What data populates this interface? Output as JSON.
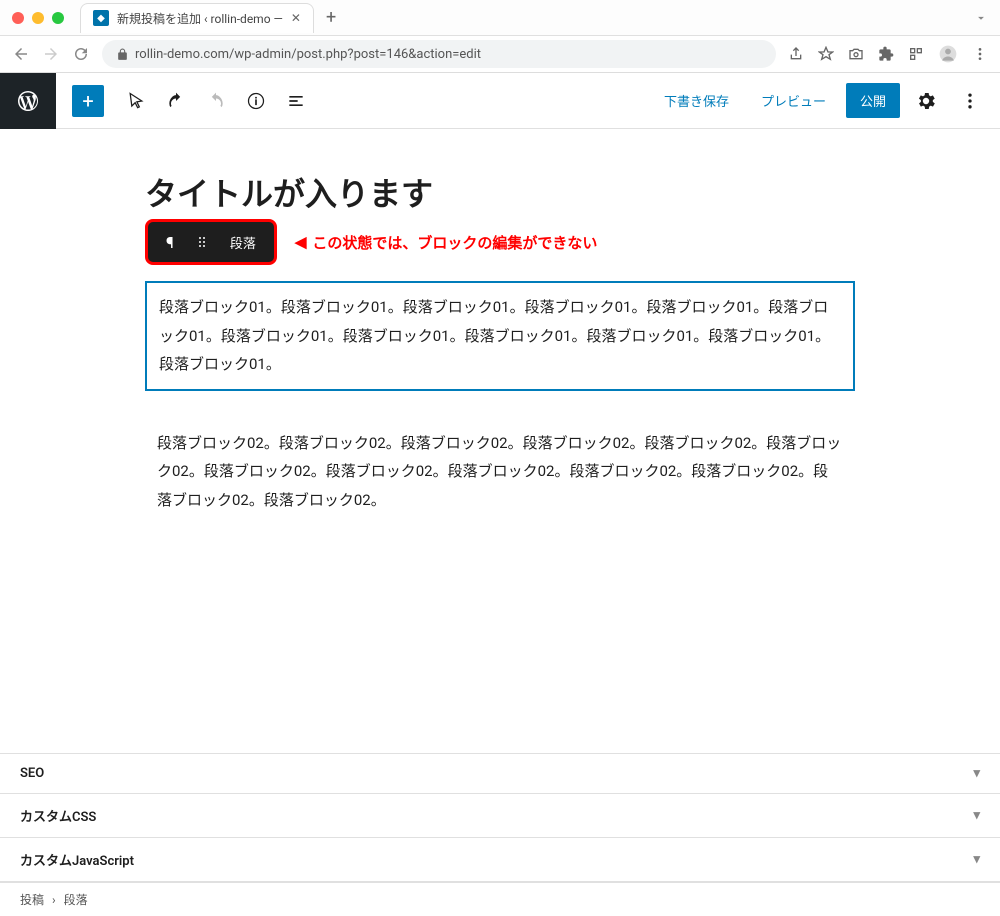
{
  "browser": {
    "tab_title": "新規投稿を追加 ‹ rollin-demo —",
    "url": "rollin-demo.com/wp-admin/post.php?post=146&action=edit"
  },
  "toolbar": {
    "save_draft": "下書き保存",
    "preview": "プレビュー",
    "publish": "公開"
  },
  "editor": {
    "title": "タイトルが入ります",
    "block_toolbar": {
      "label": "段落"
    },
    "annotation_text": "この状態では、ブロックの編集ができない",
    "paragraph1": "段落ブロック01。段落ブロック01。段落ブロック01。段落ブロック01。段落ブロック01。段落ブロック01。段落ブロック01。段落ブロック01。段落ブロック01。段落ブロック01。段落ブロック01。段落ブロック01。",
    "paragraph2": "段落ブロック02。段落ブロック02。段落ブロック02。段落ブロック02。段落ブロック02。段落ブロック02。段落ブロック02。段落ブロック02。段落ブロック02。段落ブロック02。段落ブロック02。段落ブロック02。段落ブロック02。"
  },
  "meta_boxes": [
    {
      "label": "SEO"
    },
    {
      "label": "カスタムCSS"
    },
    {
      "label": "カスタムJavaScript"
    }
  ],
  "breadcrumb": {
    "root": "投稿",
    "current": "段落"
  }
}
